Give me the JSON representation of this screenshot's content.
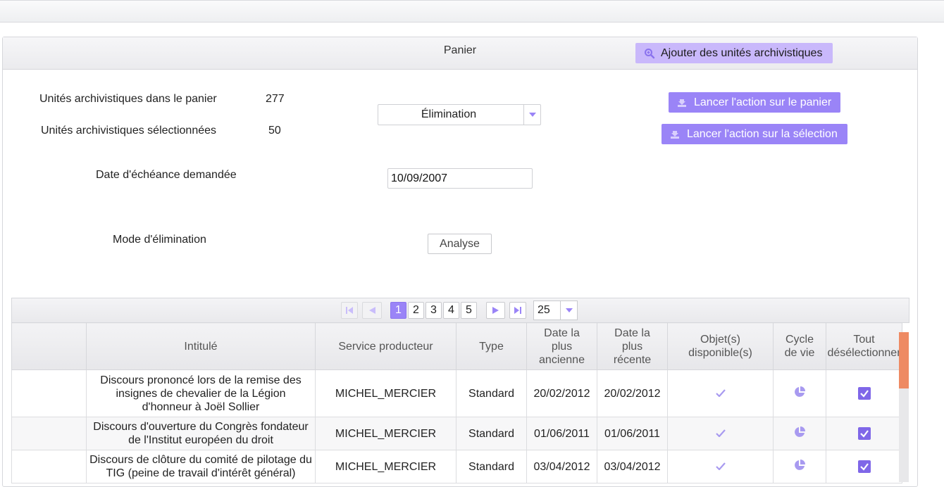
{
  "panel": {
    "title": "Panier",
    "add_button_label": "Ajouter des unités archivistiques"
  },
  "stats": {
    "in_cart_label": "Unités archivistiques dans le panier",
    "in_cart_count": "277",
    "selected_label": "Unités archivistiques sélectionnées",
    "selected_count": "50"
  },
  "action_select": {
    "value": "Élimination"
  },
  "actions": {
    "run_cart_label": "Lancer l'action sur le panier",
    "run_selection_label": "Lancer l'action sur la sélection"
  },
  "due_date": {
    "label": "Date d'échéance demandée",
    "value": "10/09/2007"
  },
  "elimination_mode": {
    "label": "Mode d'élimination",
    "button_label": "Analyse"
  },
  "pager": {
    "pages": [
      "1",
      "2",
      "3",
      "4",
      "5"
    ],
    "active_page": "1",
    "page_size": "25"
  },
  "table": {
    "headers": {
      "title": "Intitulé",
      "producer": "Service producteur",
      "type": "Type",
      "oldest_date_l1": "Date la",
      "oldest_date_l2": "plus",
      "oldest_date_l3": "ancienne",
      "newest_date_l1": "Date la",
      "newest_date_l2": "plus",
      "newest_date_l3": "récente",
      "objects_l1": "Objet(s)",
      "objects_l2": "disponible(s)",
      "lifecycle_l1": "Cycle",
      "lifecycle_l2": "de vie",
      "deselect_l1": "Tout",
      "deselect_l2": "désélectionner"
    },
    "rows": [
      {
        "title": "Discours prononcé lors de la remise des insignes de chevalier de la Légion d'honneur à Joël Sollier",
        "producer": "MICHEL_MERCIER",
        "type": "Standard",
        "oldest": "20/02/2012",
        "newest": "20/02/2012"
      },
      {
        "title": "Discours d'ouverture du Congrès fondateur de l'Institut européen du droit",
        "producer": "MICHEL_MERCIER",
        "type": "Standard",
        "oldest": "01/06/2011",
        "newest": "01/06/2011"
      },
      {
        "title": "Discours de clôture du comité de pilotage du TIG (peine de travail d'intérêt général)",
        "producer": "MICHEL_MERCIER",
        "type": "Standard",
        "oldest": "03/04/2012",
        "newest": "03/04/2012"
      }
    ]
  },
  "colors": {
    "accent": "#9a84f7",
    "accent_light": "#c9b8fb",
    "scroll_thumb": "#ee8a63"
  }
}
